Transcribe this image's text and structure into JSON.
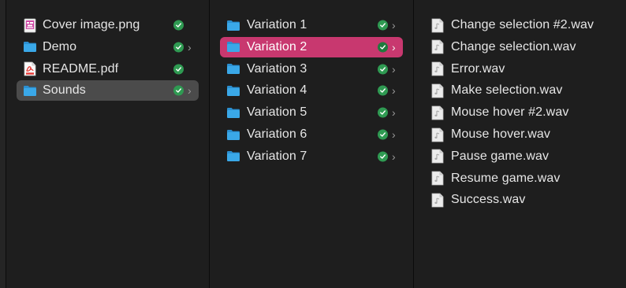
{
  "columns": [
    {
      "items": [
        {
          "name": "Cover image.png",
          "icon": "image-file-icon",
          "synced": true
        },
        {
          "name": "Demo",
          "icon": "folder-icon",
          "synced": true,
          "has_children": true
        },
        {
          "name": "README.pdf",
          "icon": "pdf-file-icon",
          "synced": true
        },
        {
          "name": "Sounds",
          "icon": "folder-icon",
          "synced": true,
          "has_children": true,
          "selected": true
        }
      ]
    },
    {
      "items": [
        {
          "name": "Variation 1",
          "icon": "folder-icon",
          "synced": true,
          "has_children": true
        },
        {
          "name": "Variation 2",
          "icon": "folder-icon",
          "synced": true,
          "has_children": true,
          "selected": true
        },
        {
          "name": "Variation 3",
          "icon": "folder-icon",
          "synced": true,
          "has_children": true
        },
        {
          "name": "Variation 4",
          "icon": "folder-icon",
          "synced": true,
          "has_children": true
        },
        {
          "name": "Variation 5",
          "icon": "folder-icon",
          "synced": true,
          "has_children": true
        },
        {
          "name": "Variation 6",
          "icon": "folder-icon",
          "synced": true,
          "has_children": true
        },
        {
          "name": "Variation 7",
          "icon": "folder-icon",
          "synced": true,
          "has_children": true
        }
      ]
    },
    {
      "items": [
        {
          "name": "Change selection #2.wav",
          "icon": "audio-file-icon"
        },
        {
          "name": "Change selection.wav",
          "icon": "audio-file-icon"
        },
        {
          "name": "Error.wav",
          "icon": "audio-file-icon"
        },
        {
          "name": "Make selection.wav",
          "icon": "audio-file-icon"
        },
        {
          "name": "Mouse hover #2.wav",
          "icon": "audio-file-icon"
        },
        {
          "name": "Mouse hover.wav",
          "icon": "audio-file-icon"
        },
        {
          "name": "Pause game.wav",
          "icon": "audio-file-icon"
        },
        {
          "name": "Resume game.wav",
          "icon": "audio-file-icon"
        },
        {
          "name": "Success.wav",
          "icon": "audio-file-icon"
        }
      ]
    }
  ],
  "colors": {
    "background": "#1e1e1e",
    "selected_active": "#c8386f",
    "selected_inactive": "#4b4b4b",
    "folder": "#3aa8e8",
    "synced_badge": "#2f9a52"
  }
}
